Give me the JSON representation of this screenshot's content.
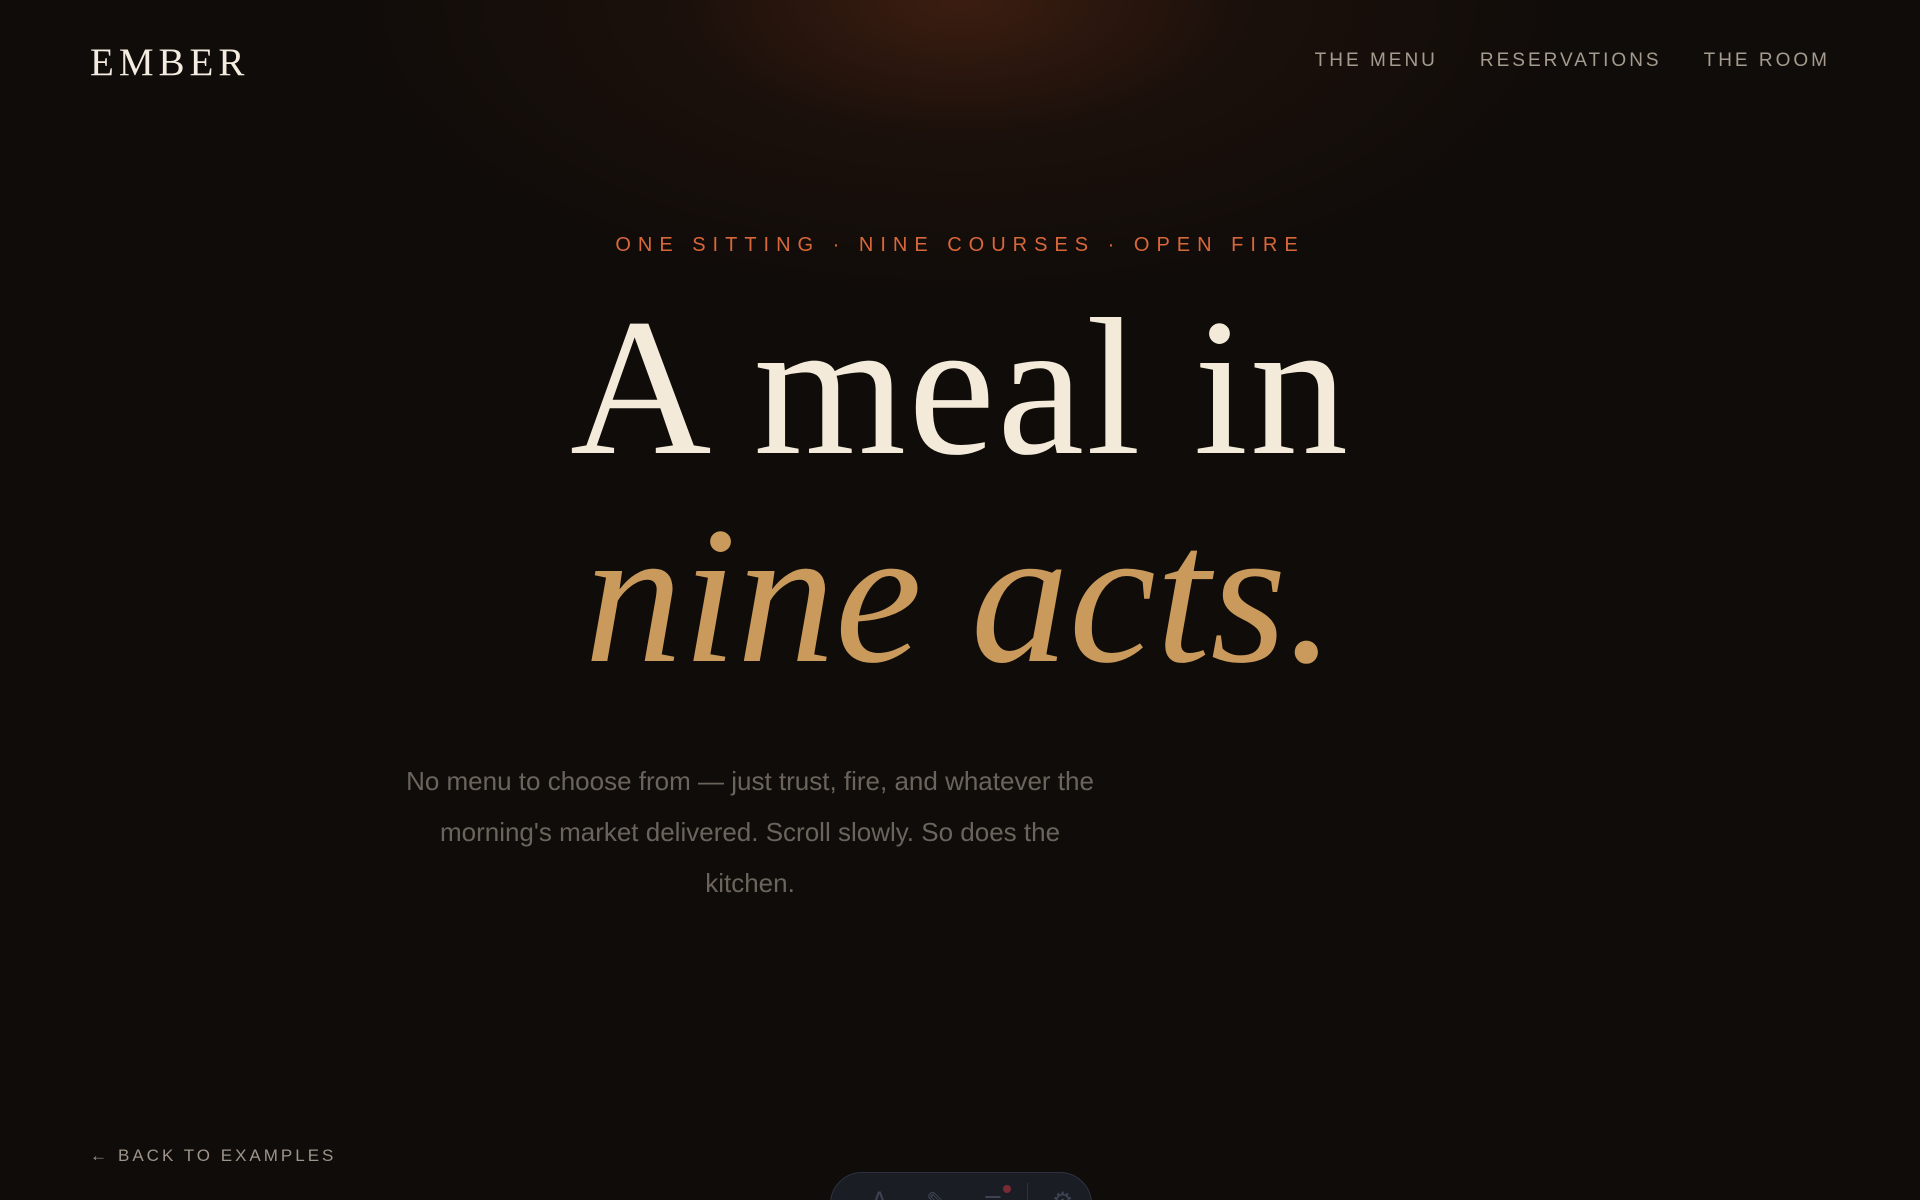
{
  "brand": {
    "logo_text": "EMBER"
  },
  "nav": {
    "links": [
      {
        "label": "THE MENU"
      },
      {
        "label": "RESERVATIONS"
      },
      {
        "label": "THE ROOM"
      }
    ]
  },
  "hero": {
    "eyebrow": "ONE SITTING · NINE COURSES · OPEN FIRE",
    "headline_line1": "A meal in",
    "headline_line2": "nine acts.",
    "subcopy": "No menu to choose from — just trust, fire, and whatever the morning's market delivered. Scroll slowly. So does the kitchen."
  },
  "footer": {
    "back_label": "BACK TO EXAMPLES",
    "back_arrow": "←"
  },
  "toolbar": {
    "buttons": [
      {
        "icon": "text-icon",
        "glyph": "A"
      },
      {
        "icon": "pen-icon",
        "glyph": "✎"
      },
      {
        "icon": "list-icon",
        "glyph": "≡",
        "has_indicator": true
      },
      {
        "icon": "gear-icon",
        "glyph": "⚙"
      }
    ]
  },
  "colors": {
    "background": "#100c0a",
    "accent_orange": "#d8673a",
    "accent_gold": "#c99a5b",
    "headline_cream": "#f3ead9"
  }
}
